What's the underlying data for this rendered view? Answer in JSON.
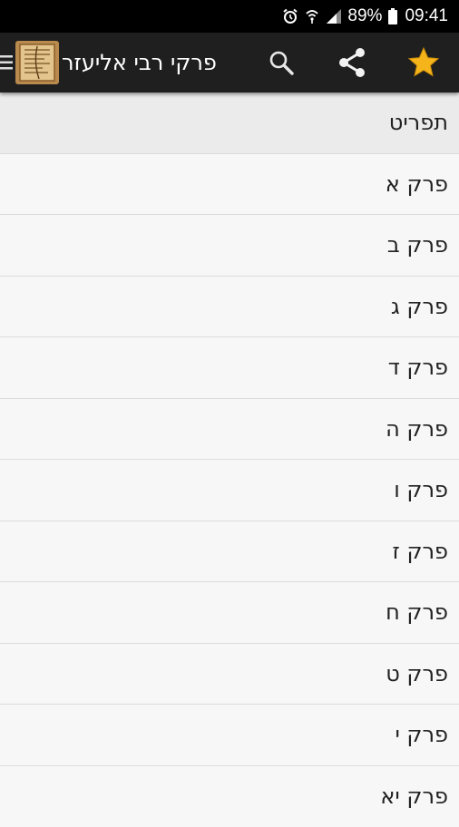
{
  "status_bar": {
    "battery_percent": "89%",
    "time": "09:41"
  },
  "toolbar": {
    "title": "פרקי רבי אליעזר",
    "icons": [
      "menu-icon",
      "app-logo",
      "search-icon",
      "share-icon",
      "star-icon"
    ],
    "star_color": "#f5b41a"
  },
  "chapters": [
    {
      "label": "תפריט"
    },
    {
      "label": "פרק א"
    },
    {
      "label": "פרק ב"
    },
    {
      "label": "פרק ג"
    },
    {
      "label": "פרק ד"
    },
    {
      "label": "פרק ה"
    },
    {
      "label": "פרק ו"
    },
    {
      "label": "פרק ז"
    },
    {
      "label": "פרק ח"
    },
    {
      "label": "פרק ט"
    },
    {
      "label": "פרק י"
    },
    {
      "label": "פרק יא"
    }
  ]
}
